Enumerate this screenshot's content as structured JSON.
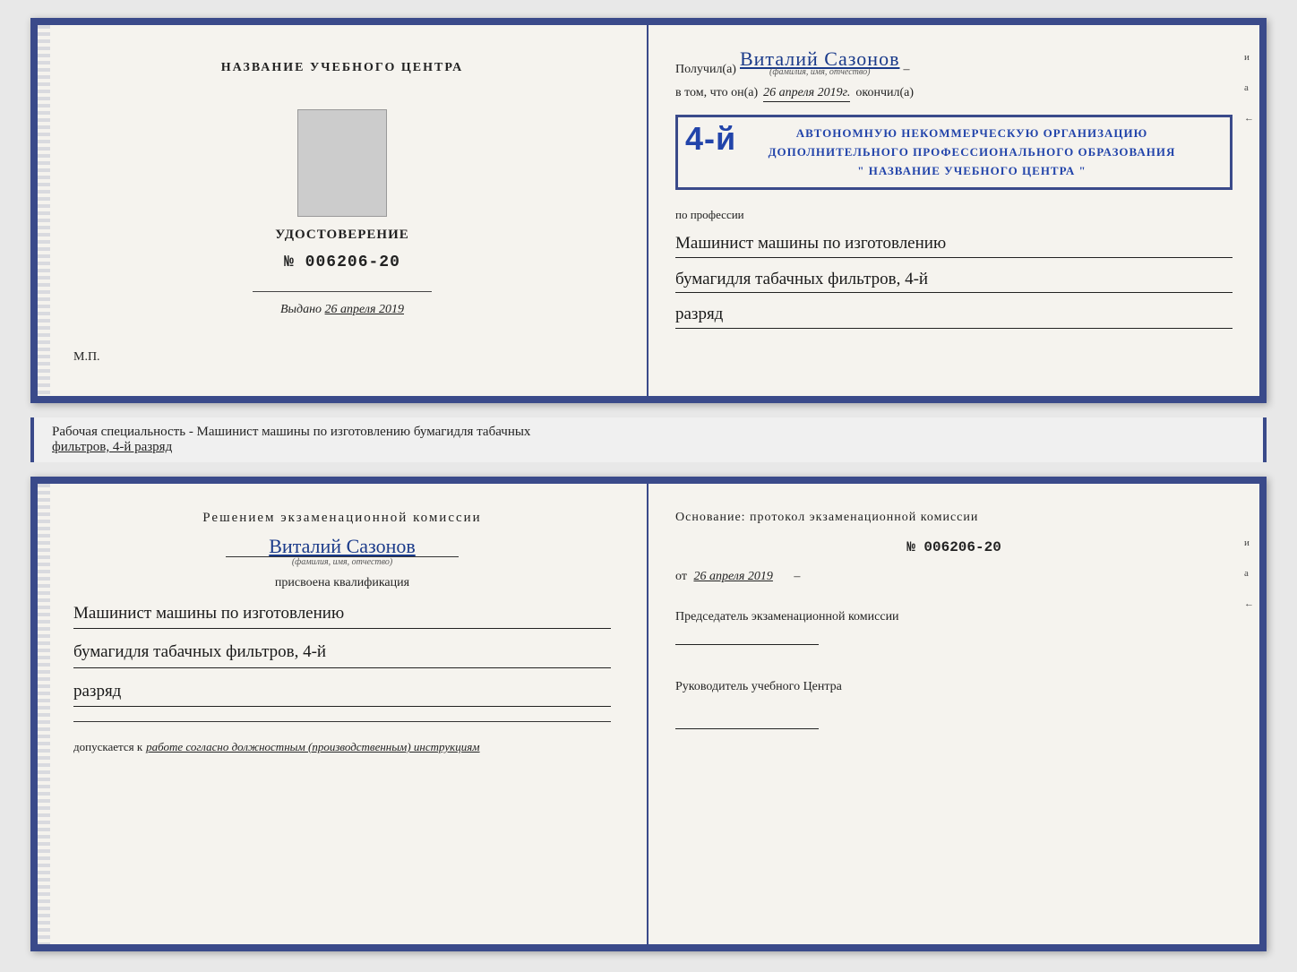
{
  "topDoc": {
    "left": {
      "title": "НАЗВАНИЕ УЧЕБНОГО ЦЕНТРА",
      "photo_alt": "photo",
      "cert_label": "УДОСТОВЕРЕНИЕ",
      "cert_number": "№ 006206-20",
      "vydano_label": "Выдано",
      "vydano_date": "26 апреля 2019",
      "mp_label": "М.П."
    },
    "right": {
      "poluchil_prefix": "Получил(а)",
      "recipient_name": "Виталий Сазонов",
      "recipient_sub": "(фамилия, имя, отчество)",
      "dash": "–",
      "vtom_prefix": "в том, что он(а)",
      "vtom_date": "26 апреля 2019г.",
      "vtom_okonchil": "окончил(а)",
      "stamp_num": "4-й",
      "stamp_line1": "АВТОНОМНУЮ НЕКОММЕРЧЕСКУЮ ОРГАНИЗАЦИЮ",
      "stamp_line2": "ДОПОЛНИТЕЛЬНОГО ПРОФЕССИОНАЛЬНОГО ОБРАЗОВАНИЯ",
      "stamp_line3": "\" НАЗВАНИЕ УЧЕБНОГО ЦЕНТРА \"",
      "i_mark": "и",
      "a_mark": "а",
      "arrow_mark": "←",
      "po_professii": "по профессии",
      "profession1": "Машинист машины по изготовлению",
      "profession2": "бумагидля табачных фильтров, 4-й",
      "profession3": "разряд"
    }
  },
  "middleText": {
    "text1": "Рабочая специальность - Машинист машины по изготовлению бумагидля табачных",
    "text2": "фильтров, 4-й разряд"
  },
  "bottomDoc": {
    "left": {
      "decision_title": "Решением  экзаменационной  комиссии",
      "name": "Виталий Сазонов",
      "name_sub": "(фамилия, имя, отчество)",
      "prisvoena": "присвоена квалификация",
      "qual1": "Машинист машины по изготовлению",
      "qual2": "бумагидля табачных фильтров, 4-й",
      "qual3": "разряд",
      "dopuskaetsya_prefix": "допускается к",
      "dopuskaetsya_val": "работе согласно должностным (производственным) инструкциям"
    },
    "right": {
      "osnovaniye": "Основание:  протокол  экзаменационной  комиссии",
      "number": "№  006206-20",
      "ot_prefix": "от",
      "ot_date": "26 апреля 2019",
      "predsedatel_title": "Председатель экзаменационной комиссии",
      "rukovoditel_title": "Руководитель учебного Центра",
      "i_mark": "и",
      "a_mark": "а",
      "arrow_mark": "←"
    }
  }
}
